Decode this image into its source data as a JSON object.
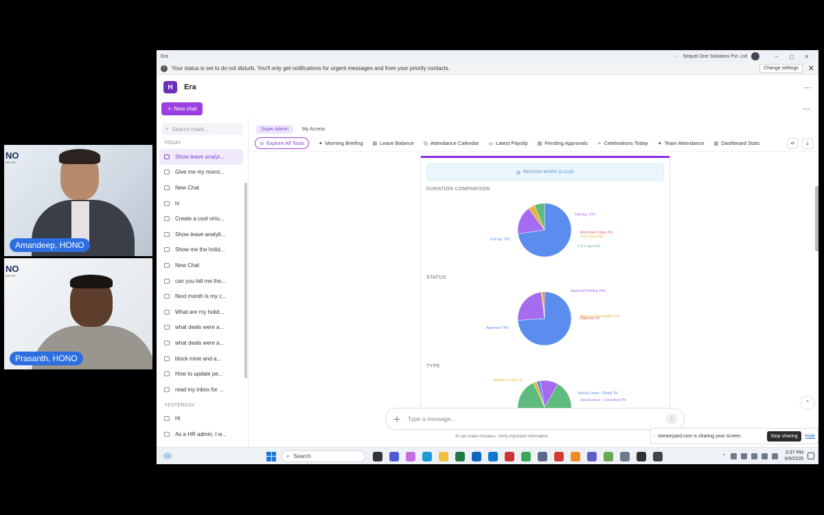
{
  "participants": [
    {
      "name": "Amandeep, HONO",
      "brand": "NO",
      "brand_sub": "OPLE"
    },
    {
      "name": "Prasanth, HONO",
      "brand": "NO",
      "brand_sub": "OPLE"
    }
  ],
  "window": {
    "title": "Era",
    "org": "Sequel One Solutions Pvt. Ltd",
    "controls": [
      "–",
      "▢",
      "✕"
    ]
  },
  "notification": {
    "message": "Your status is set to do not disturb. You'll only get notifications for urgent messages and from your priority contacts.",
    "button": "Change settings"
  },
  "app": {
    "logo_letter": "H",
    "name": "Era",
    "new_chat": "New chat"
  },
  "sidebar": {
    "search_placeholder": "Search chats...",
    "groups": [
      {
        "label": "TODAY",
        "items": [
          "Show leave analyt...",
          "Give me my morni...",
          "New Chat",
          "hi",
          "Create a cool virtu...",
          "Show leave analyti...",
          "Show me the holid...",
          "New Chat",
          "can you tell me the...",
          "Next month is my c...",
          "What are my holid...",
          "what deals were a...",
          "what deals were a...",
          "block mine and a...",
          "How to update pe...",
          "read my inbox for ..."
        ]
      },
      {
        "label": "YESTERDAY",
        "items": [
          "Hi",
          "As a HR admin, I w..."
        ]
      }
    ],
    "active_index": 0
  },
  "access_tabs": [
    "Super Admin",
    "My Access"
  ],
  "tools": [
    "Explore All Tools",
    "Morning Briefing",
    "Leave Balance",
    "Attendance Calendar",
    "Latest Payslip",
    "Pending Approvals",
    "Celebrations Today",
    "Team Attendance",
    "Dashboard Stats"
  ],
  "card": {
    "word_cloud_button": "REASON WORD CLOUD",
    "sections": [
      "DURATION COMPARISON",
      "STATUS",
      "TYPE"
    ]
  },
  "chart_data": [
    {
      "type": "pie",
      "title": "DURATION COMPARISON",
      "categories": [
        "Full day",
        "Half day",
        "More than 5 days",
        "2 to 5 days",
        "1 to 2 days"
      ],
      "values": [
        72,
        17,
        0,
        4,
        6
      ],
      "labels": [
        "Full day 72%",
        "Half day 17%",
        "More than 5 days 0%",
        "2 to 5 days 4%",
        "1 to 2 days 6%"
      ],
      "colors": [
        "#5b8def",
        "#a56cf0",
        "#e0605a",
        "#e8b53c",
        "#5fba7d"
      ]
    },
    {
      "type": "pie",
      "title": "STATUS",
      "categories": [
        "Approved",
        "Approval Pending",
        "Approval Cancellation",
        "Rejected"
      ],
      "values": [
        74,
        24,
        1,
        1
      ],
      "labels": [
        "Approved 74%",
        "Approval Pending 24%",
        "Approval Cancellation 1%",
        "Rejected 1%"
      ],
      "colors": [
        "#5b8def",
        "#a56cf0",
        "#e8b53c",
        "#e0605a"
      ]
    },
    {
      "type": "pie",
      "title": "TYPE",
      "categories": [
        "Casual Leave",
        "Statutory Leave",
        "Special Leave - Global",
        "Special leave - Consultant"
      ],
      "values": [
        39,
        1,
        1,
        5
      ],
      "labels": [
        "Casual Leave 39%",
        "Statutory Leave 1%",
        "Special Leave - Global 1%",
        "Special leave - Consultant 5%"
      ],
      "colors": [
        "#5fba7d",
        "#e8b53c",
        "#5b8def",
        "#a56cf0"
      ]
    }
  ],
  "composer": {
    "placeholder": "Type a message...",
    "disclaimer": "AI can make mistakes. Verify important information."
  },
  "screen_share": {
    "text": "streamyard.com is sharing your screen.",
    "stop": "Stop sharing",
    "hide": "Hide"
  },
  "taskbar": {
    "search_label": "Search",
    "time": "3:37 PM",
    "date": "6/9/2026"
  }
}
